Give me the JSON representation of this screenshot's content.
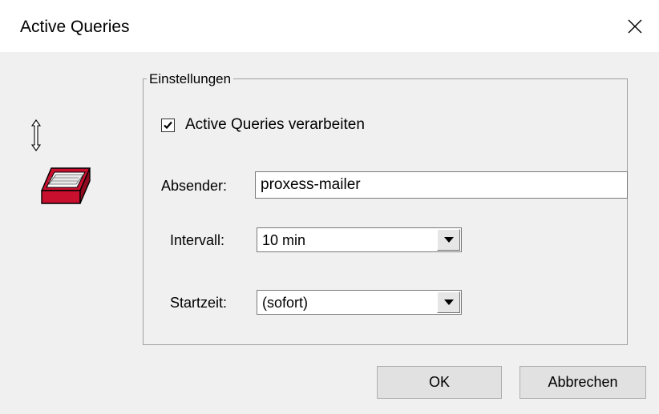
{
  "window": {
    "title": "Active Queries",
    "close_icon": "close-icon"
  },
  "icons": {
    "move": "vertical-resize-arrow-icon",
    "tray": "inbox-tray-icon",
    "dropdown": "dropdown-arrow-icon",
    "checkmark": "checkmark-icon"
  },
  "group": {
    "title": "Einstellungen",
    "checkbox": {
      "label": "Active Queries verarbeiten",
      "checked": true
    },
    "sender": {
      "label": "Absender:",
      "value": "proxess-mailer"
    },
    "interval": {
      "label": "Intervall:",
      "value": "10 min"
    },
    "start": {
      "label": "Startzeit:",
      "value": "(sofort)"
    }
  },
  "buttons": {
    "ok": "OK",
    "cancel": "Abbrechen"
  },
  "colors": {
    "tray_red": "#c8102e",
    "dialog_bg": "#f0f0f0",
    "title_bg": "#ffffff"
  }
}
